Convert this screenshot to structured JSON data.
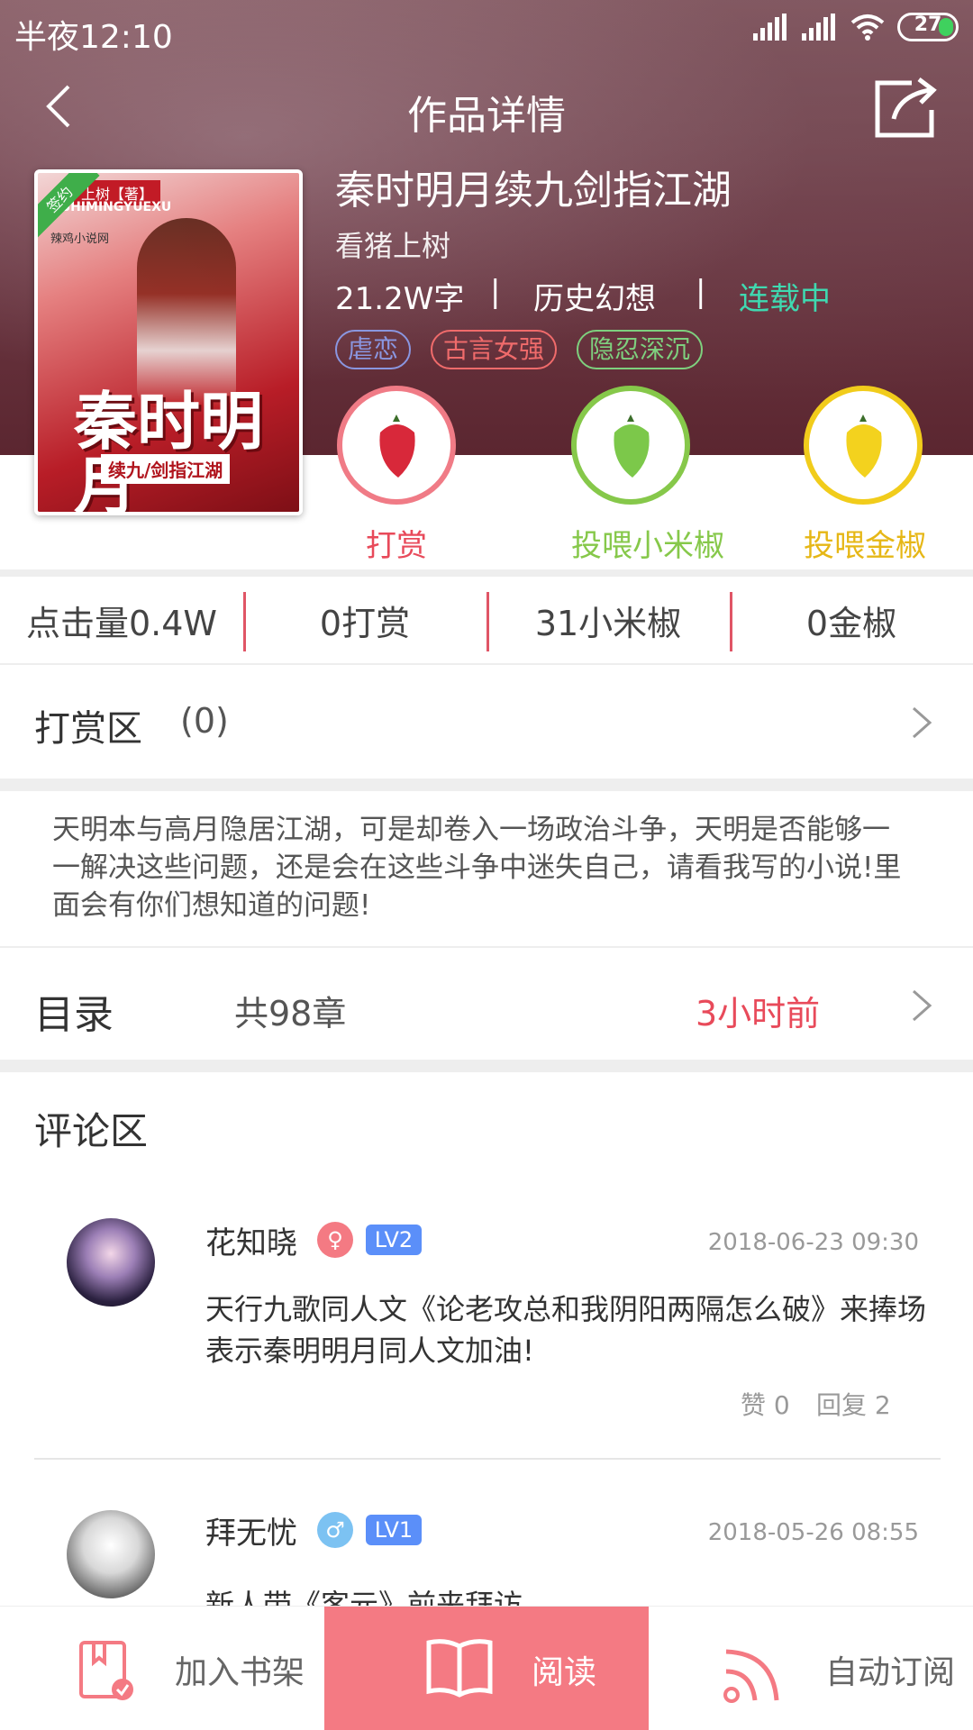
{
  "status_bar": {
    "time": "半夜12:10",
    "battery": "27"
  },
  "header": {
    "title": "作品详情"
  },
  "book": {
    "title": "秦时明月续九剑指江湖",
    "author": "看猪上树",
    "word_count": "21.2W字",
    "separator": "|",
    "category": "历史幻想",
    "status": "连载中",
    "tags": [
      {
        "label": "虐恋",
        "color": "#8a96e0"
      },
      {
        "label": "古言女强",
        "color": "#f06b6b"
      },
      {
        "label": "隐忍深沉",
        "color": "#7ed07e"
      }
    ],
    "cover": {
      "signed": "签约",
      "author_strip": "上树【著】",
      "pinyin": "SHIMINGYUEXU",
      "logo": "辣鸡小说网",
      "big_title": "秦时明月",
      "subtitle": "续九/剑指江湖"
    }
  },
  "actions": [
    {
      "label": "打赏",
      "color": "#e84a5a",
      "pepper": "#d8283a"
    },
    {
      "label": "投喂小米椒",
      "color": "#86c84a",
      "pepper": "#7cc84a"
    },
    {
      "label": "投喂金椒",
      "color": "#f1cc1b",
      "pepper": "#f3d21e"
    }
  ],
  "stats": [
    "点击量0.4W",
    "0打赏",
    "31小米椒",
    "0金椒"
  ],
  "reward": {
    "label": "打赏区",
    "count": "(0)"
  },
  "description": "天明本与高月隐居江湖，可是却卷入一场政治斗争，天明是否能够一一解决这些问题，还是会在这些斗争中迷失自己，请看我写的小说!里面会有你们想知道的问题!",
  "catalog": {
    "label": "目录",
    "count": "共98章",
    "updated": "3小时前"
  },
  "comments_title": "评论区",
  "comments": [
    {
      "name": "花知晓",
      "gender": "female",
      "gender_color": "#f47a83",
      "level": "LV2",
      "time": "2018-06-23 09:30",
      "text_line1": "天行九歌同人文《论老攻总和我阴阳两隔怎么破》来捧场",
      "text_line2": "表示秦明明月同人文加油!",
      "likes": "赞 0",
      "replies": "回复 2"
    },
    {
      "name": "拜无忧",
      "gender": "male",
      "gender_color": "#7cc2f2",
      "level": "LV1",
      "time": "2018-05-26 08:55",
      "text_line1": "新人带《客元》前来拜访",
      "text_line2": ""
    }
  ],
  "bottom_bar": {
    "add_shelf": "加入书架",
    "read": "阅读",
    "auto_subscribe": "自动订阅"
  },
  "colors": {
    "accent": "#f47a83",
    "status_green": "#3fd9b0",
    "divider_red": "#e05566"
  }
}
